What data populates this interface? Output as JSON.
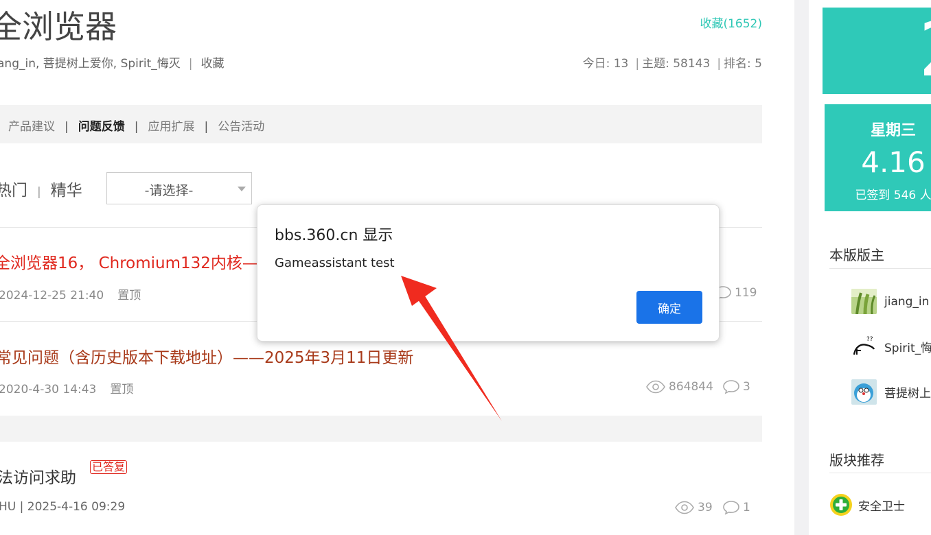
{
  "header": {
    "forum_title": "全浏览器",
    "favorite_count": "收藏(1652)",
    "moderators_text": "ang_in, 菩提树上爱你, Spirit_悔灭",
    "favorite_link": "收藏",
    "today": "今日: 13",
    "topics": "主题: 58143",
    "rank": "排名: 5"
  },
  "categories": {
    "items": [
      "产品建议",
      "问题反馈",
      "应用扩展",
      "公告活动"
    ],
    "active_index": 1
  },
  "filters": {
    "hot": "热门",
    "featured": "精华",
    "select_value": "-请选择-"
  },
  "threads": [
    {
      "title": "全浏览器16， Chromium132内核—",
      "date": "2024-12-25 21:40",
      "pinned": "置顶",
      "replies": "119"
    },
    {
      "title": "常见问题（含历史版本下载地址）——2025年3月11日更新",
      "date": "2020-4-30 14:43",
      "pinned": "置顶",
      "views": "864844",
      "replies": "3"
    },
    {
      "title": "法访问求助",
      "badge": "已答复",
      "meta": "HU | 2025-4-16 09:29",
      "views": "39",
      "replies": "1"
    }
  ],
  "sidebar": {
    "partial_big_text": "2",
    "weekday": "星期三",
    "date": "4.16",
    "signed": "已签到 546 人",
    "moderators_heading": "本版版主",
    "moderators": [
      "jiang_in",
      "Spirit_悔",
      "菩提树上"
    ],
    "recommend_heading": "版块推荐",
    "recommend_item": "安全卫士"
  },
  "dialog": {
    "title": "bbs.360.cn 显示",
    "message": "Gameassistant test",
    "ok_label": "确定"
  },
  "colors": {
    "teal": "#2fc9b8",
    "thread_red": "#e0281e",
    "thread_brown": "#a83a1a",
    "button_blue": "#1a73e8",
    "annotation_arrow": "#f02b1f"
  }
}
